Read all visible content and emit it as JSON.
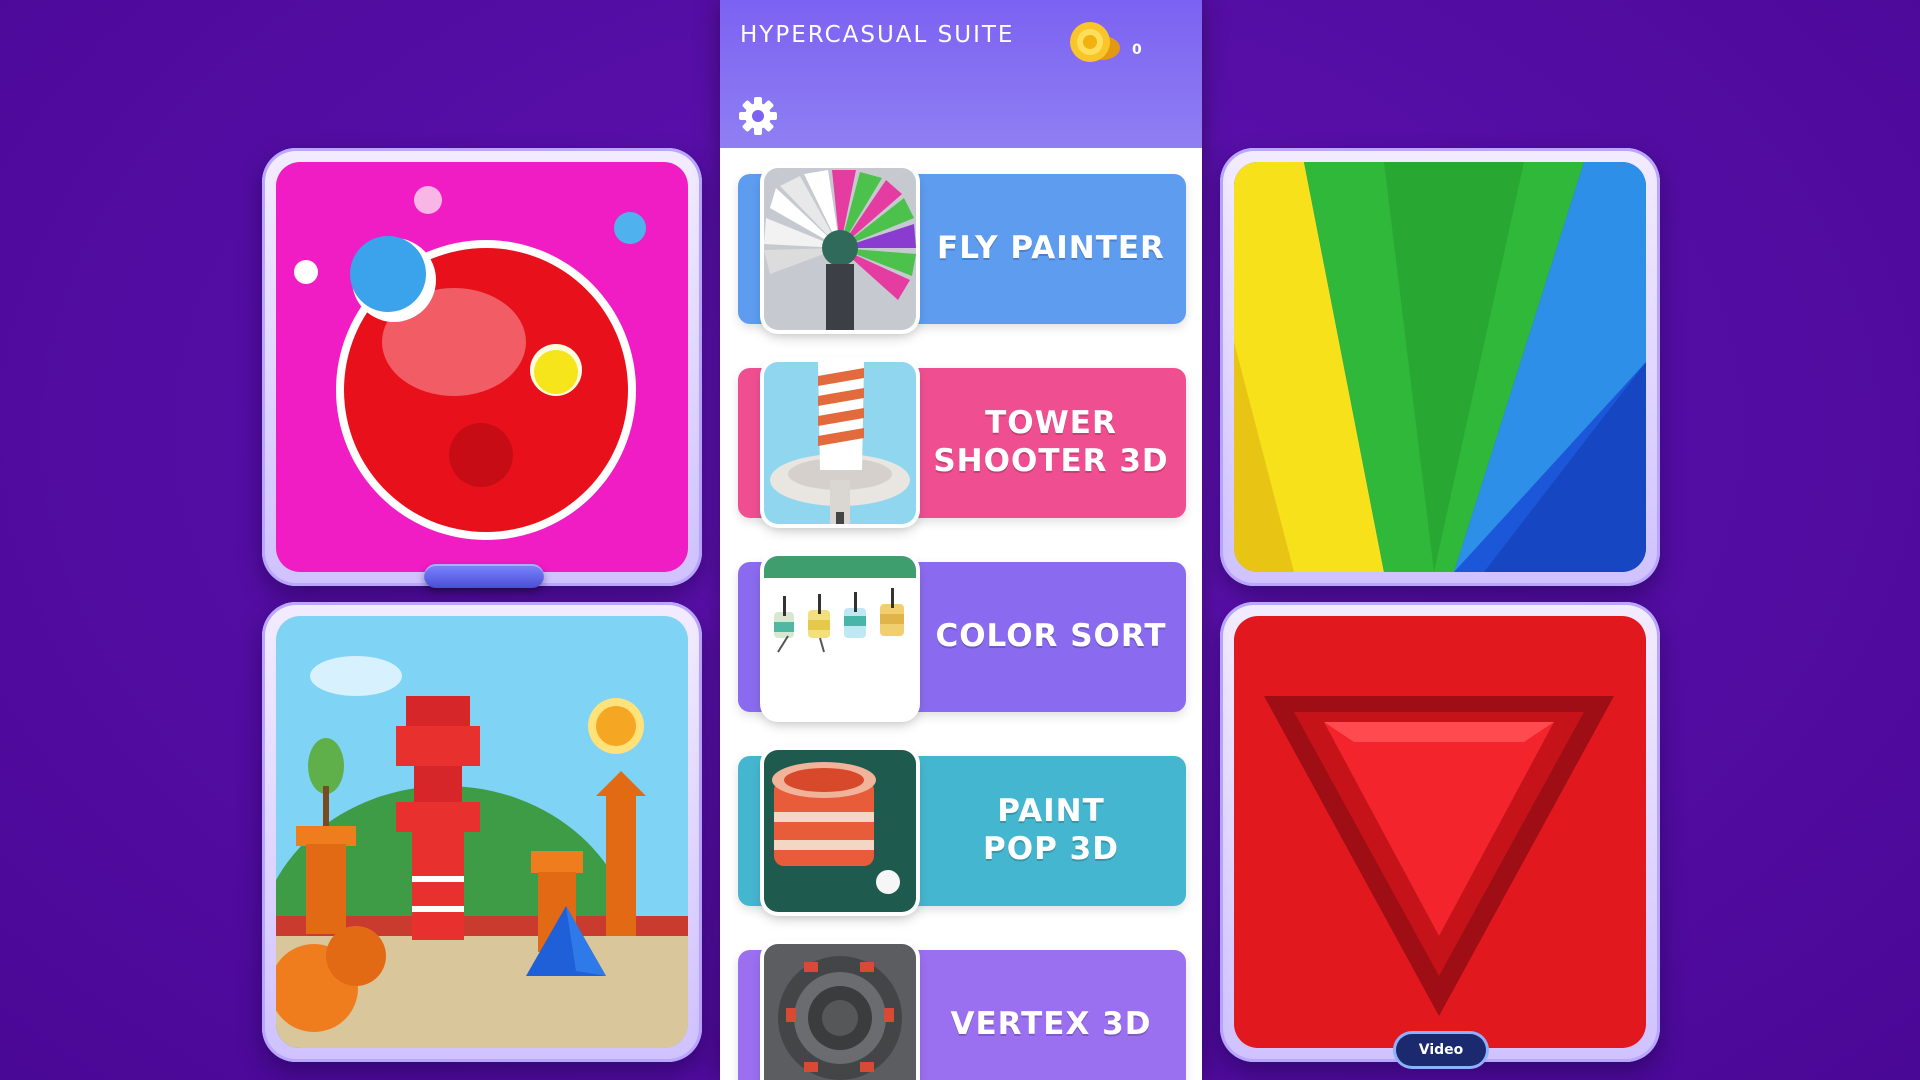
{
  "header": {
    "title": "HYPERCASUAL SUITE",
    "coin_count": "0",
    "settings_icon": "gear-icon",
    "coin_icon": "coin-icon"
  },
  "games": [
    {
      "name": "FLY PAINTER",
      "color": "#5e9cf0"
    },
    {
      "name": "TOWER\nSHOOTER 3D",
      "color": "#ef4f91"
    },
    {
      "name": "COLOR SORT",
      "color": "#8a6bef"
    },
    {
      "name": "PAINT\nPOP 3D",
      "color": "#45b6cf"
    },
    {
      "name": "VERTEX 3D",
      "color": "#9a6ff0"
    }
  ],
  "side_tiles": {
    "top_left": "ball-game-art",
    "bottom_left": "tower-landscape-art",
    "top_right": "color-stripes-art",
    "bottom_right": "red-triangle-art"
  },
  "video_badge": "Video",
  "colors": {
    "background": "#560ea6",
    "header": "#7c62f2"
  }
}
